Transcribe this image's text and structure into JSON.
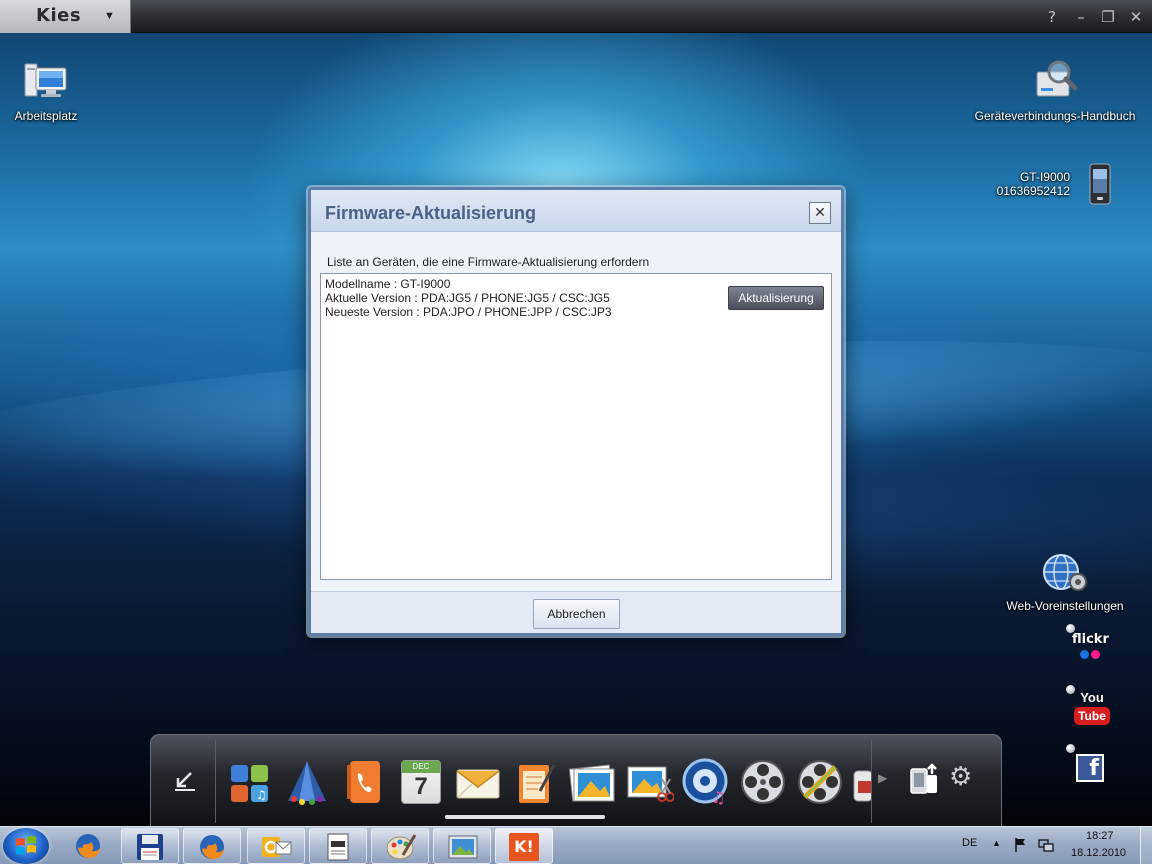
{
  "app": {
    "logo": "Kies",
    "menu_arrow": "▼",
    "controls": [
      "?",
      "–",
      "❐",
      "✕"
    ]
  },
  "desktop": {
    "my_computer_label": "Arbeitsplatz",
    "connection_guide_label": "Geräteverbindungs-Handbuch",
    "device_model": "GT-I9000",
    "device_number": "01636952412",
    "web_settings_label": "Web-Voreinstellungen"
  },
  "dialog": {
    "title": "Firmware-Aktualisierung",
    "close_symbol": "✕",
    "subtitle": "Liste an Geräten, die eine Firmware-Aktualisierung erfordern",
    "device": {
      "model_line": "Modellname : GT-I9000",
      "current_version_line": "Aktuelle Version : PDA:JG5 / PHONE:JG5 / CSC:JG5",
      "latest_version_line": "Neueste Version : PDA:JPO / PHONE:JPP / CSC:JP3"
    },
    "update_button": "Aktualisierung",
    "cancel_button": "Abbrechen"
  },
  "web_links": {
    "flickr": "flickr",
    "youtube_top": "You",
    "youtube_bottom": "Tube",
    "facebook": "f"
  },
  "dock": {
    "calendar_month": "DEC",
    "calendar_day": "7",
    "apps": [
      "contacts-app",
      "triangle-app",
      "phone-app",
      "calendar-app",
      "messages-app",
      "notes-app",
      "photos-app",
      "photo-edit-app",
      "music-app",
      "video-app",
      "video-edit-app"
    ]
  },
  "taskbar": {
    "language": "DE",
    "time": "18:27",
    "date": "18.12.2010",
    "kies_icon_text": "K!"
  },
  "colors": {
    "dialog_title": "#4a6286",
    "update_button": "#5a606c",
    "taskbar": "#9aabc6"
  }
}
